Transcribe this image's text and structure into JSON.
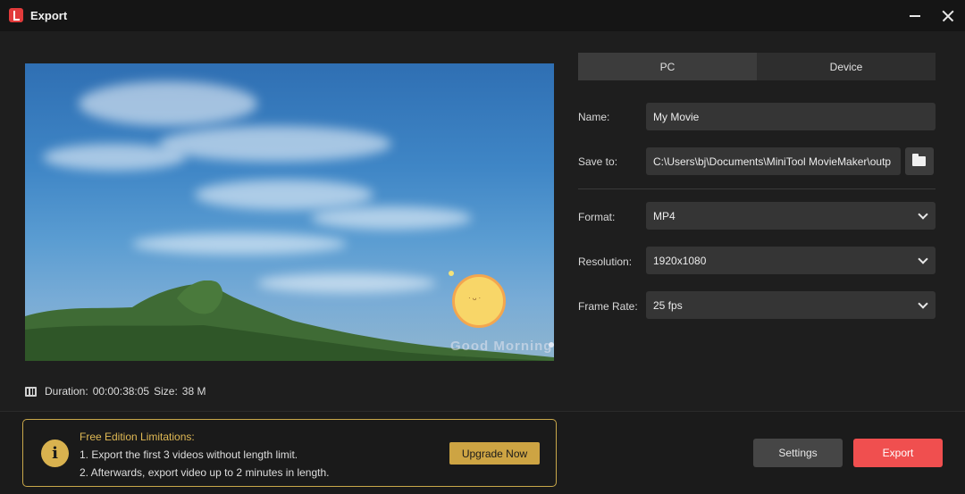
{
  "window": {
    "title": "Export",
    "icons": {
      "app": "app-logo-icon",
      "minimize": "minimize-icon",
      "close": "close-icon"
    }
  },
  "preview": {
    "watermark": "Good Morning",
    "sun_face": "· ᴗ ·"
  },
  "video_info": {
    "duration_label": "Duration:",
    "duration_value": "00:00:38:05",
    "size_label": "Size:",
    "size_value": "38 M"
  },
  "tabs": [
    {
      "label": "PC",
      "active": true
    },
    {
      "label": "Device",
      "active": false
    }
  ],
  "fields": {
    "name": {
      "label": "Name:",
      "value": "My Movie"
    },
    "save_to": {
      "label": "Save to:",
      "value": "C:\\Users\\bj\\Documents\\MiniTool MovieMaker\\outp"
    },
    "format": {
      "label": "Format:",
      "value": "MP4"
    },
    "resolution": {
      "label": "Resolution:",
      "value": "1920x1080"
    },
    "frame_rate": {
      "label": "Frame Rate:",
      "value": "25 fps"
    }
  },
  "limitations": {
    "title": "Free Edition Limitations:",
    "line1": "1. Export the first 3 videos without length limit.",
    "line2": "2. Afterwards, export video up to 2 minutes in length.",
    "upgrade_label": "Upgrade Now",
    "info_glyph": "i"
  },
  "buttons": {
    "settings": "Settings",
    "export": "Export"
  },
  "colors": {
    "accent_red": "#f04f4f",
    "accent_gold": "#cda443",
    "background": "#1e1e1e"
  }
}
